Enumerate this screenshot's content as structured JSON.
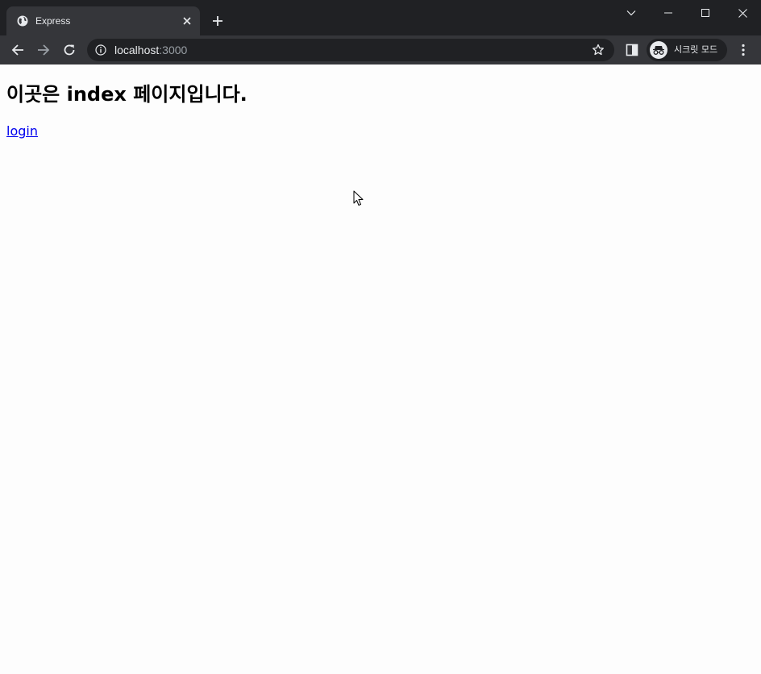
{
  "browser": {
    "tab": {
      "title": "Express"
    },
    "address": {
      "host": "localhost",
      "port": ":3000"
    },
    "profile": {
      "label": "시크릿 모드"
    },
    "icons": {
      "favicon": "globe-icon",
      "tab_close": "close-icon",
      "new_tab": "plus-icon",
      "tab_search": "chevron-down-icon",
      "minimize": "minimize-icon",
      "maximize": "maximize-icon",
      "close_window": "close-icon",
      "back": "back-arrow-icon",
      "forward": "forward-arrow-icon",
      "reload": "reload-icon",
      "site_info": "info-icon",
      "bookmark": "star-icon",
      "side_panel": "side-panel-icon",
      "incognito": "incognito-icon",
      "menu": "kebab-menu-icon"
    }
  },
  "page": {
    "heading": "이곳은 index 페이지입니다.",
    "login_link": "login"
  }
}
